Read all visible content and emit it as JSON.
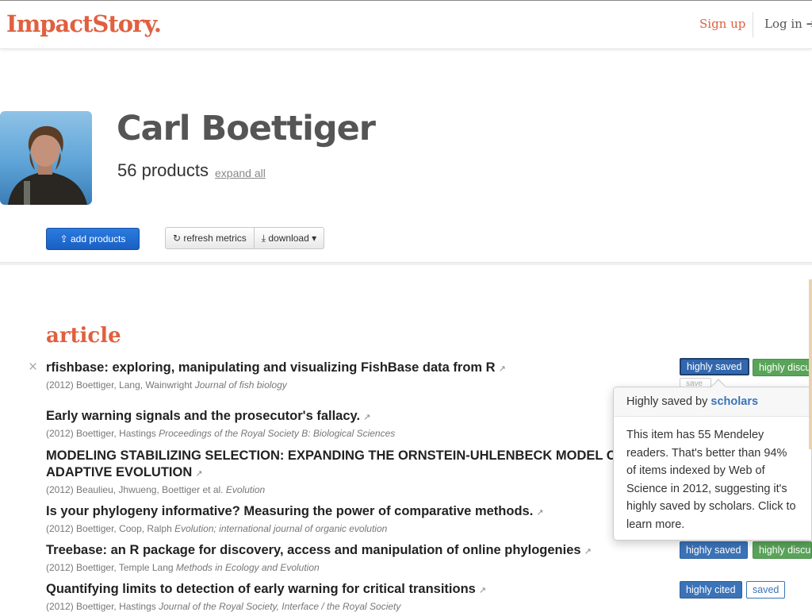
{
  "header": {
    "logo": "ImpactStory.",
    "signup_label": "Sign up",
    "login_label": "Log in ➔"
  },
  "profile": {
    "name": "Carl Boettiger",
    "products_count": "56 products",
    "expand_label": "expand all"
  },
  "toolbar": {
    "add_label": "⇪ add products",
    "refresh_label": "↻ refresh metrics",
    "download_label": "⤓ download ▾"
  },
  "section": {
    "heading": "article"
  },
  "products": [
    {
      "title": "rfishbase: exploring, manipulating and visualizing FishBase data from R",
      "year": "(2012)",
      "authors": "Boettiger, Lang, Wainwright",
      "journal": "Journal of fish biology",
      "badges": [
        "highly saved",
        "highly discu",
        "save"
      ]
    },
    {
      "title": "Early warning signals and the prosecutor's fallacy.",
      "year": "(2012)",
      "authors": "Boettiger, Hastings",
      "journal": "Proceedings of the Royal Society B: Biological Sciences"
    },
    {
      "title": "MODELING STABILIZING SELECTION: EXPANDING THE ORNSTEIN-UHLENBECK MODEL OF ADAPTIVE EVOLUTION",
      "year": "(2012)",
      "authors": "Beaulieu, Jhwueng, Boettiger et al.",
      "journal": "Evolution"
    },
    {
      "title": "Is your phylogeny informative? Measuring the power of comparative methods.",
      "year": "(2012)",
      "authors": "Boettiger, Coop, Ralph",
      "journal": "Evolution; international journal of organic evolution"
    },
    {
      "title": "Treebase: an R package for discovery, access and manipulation of online phylogenies",
      "year": "(2012)",
      "authors": "Boettiger, Temple Lang",
      "journal": "Methods in Ecology and Evolution",
      "badges": [
        "highly saved",
        "highly discu"
      ]
    },
    {
      "title": "Quantifying limits to detection of early warning for critical transitions",
      "year": "(2012)",
      "authors": "Boettiger, Hastings",
      "journal": "Journal of the Royal Society, Interface / the Royal Society",
      "badges": [
        "highly cited",
        "saved"
      ]
    }
  ],
  "popover": {
    "title_prefix": "Highly saved by",
    "title_highlight": "scholars",
    "body": "This item has 55 Mendeley readers. That's better than 94% of items indexed by Web of Science in 2012, suggesting it's highly saved by scholars. Click to learn more."
  },
  "icons": {
    "remove": "×",
    "external_link": "↗"
  },
  "colors": {
    "brand": "#e0603f",
    "primary_button": "#1a5fc2",
    "badge_saved": "#3b73b9",
    "badge_discussed": "#5aa45a"
  }
}
